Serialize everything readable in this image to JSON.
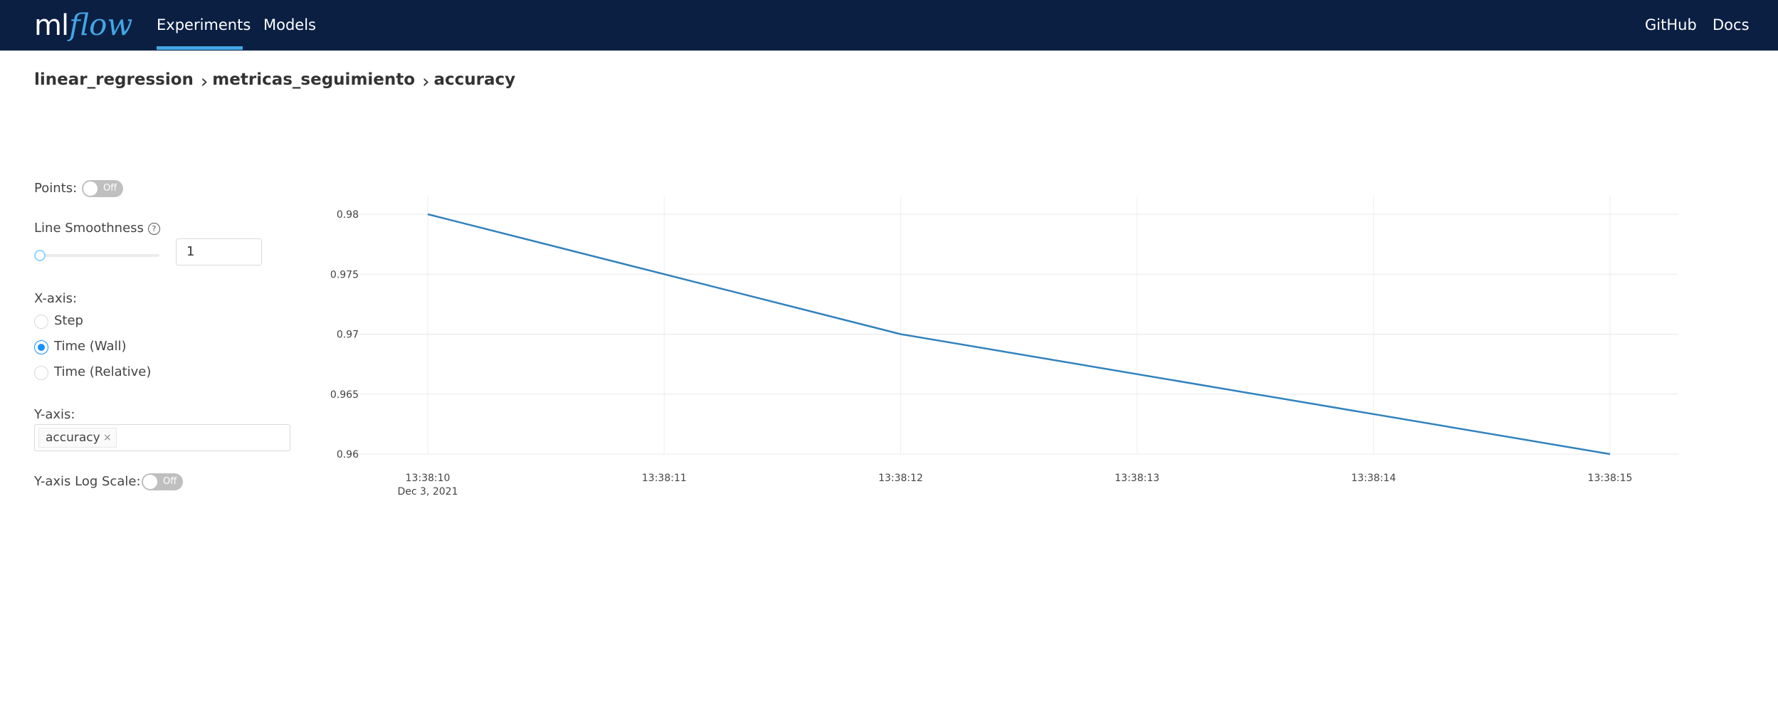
{
  "header": {
    "logo_ml": "ml",
    "logo_flow": "flow",
    "nav": {
      "experiments": "Experiments",
      "models": "Models",
      "github": "GitHub",
      "docs": "Docs"
    }
  },
  "breadcrumb": {
    "experiment": "linear_regression",
    "run": "metricas_seguimiento",
    "metric": "accuracy",
    "separator": "›"
  },
  "controls": {
    "points_label": "Points:",
    "points_toggle": "Off",
    "smoothness_label": "Line Smoothness",
    "smoothness_help": "?",
    "smoothness_slider": 1,
    "smoothness_value": "1",
    "xaxis_label": "X-axis:",
    "xaxis_options": [
      "Step",
      "Time (Wall)",
      "Time (Relative)"
    ],
    "xaxis_selected": "Time (Wall)",
    "yaxis_label": "Y-axis:",
    "yaxis_tag": "accuracy",
    "yaxis_tag_close": "×",
    "log_scale_label": "Y-axis Log Scale:",
    "log_scale_toggle": "Off"
  },
  "colors": {
    "navbar": "#0b1f43",
    "accent": "#43a6e5",
    "line": "#3182bd"
  },
  "chart_data": {
    "type": "line",
    "x": [
      "13:38:10",
      "13:38:12",
      "13:38:15"
    ],
    "x_ticks": [
      "13:38:10",
      "13:38:11",
      "13:38:12",
      "13:38:13",
      "13:38:14",
      "13:38:15"
    ],
    "x_date_label": "Dec 3, 2021",
    "series": [
      {
        "name": "accuracy",
        "x_seconds": [
          10,
          12,
          15
        ],
        "values": [
          0.98,
          0.97,
          0.96
        ]
      }
    ],
    "y_ticks": [
      "0.98",
      "0.975",
      "0.97",
      "0.965",
      "0.96"
    ],
    "ylim": [
      0.96,
      0.98
    ],
    "xlim": [
      "13:38:10",
      "13:38:15"
    ],
    "grid": true,
    "legend": "none"
  }
}
